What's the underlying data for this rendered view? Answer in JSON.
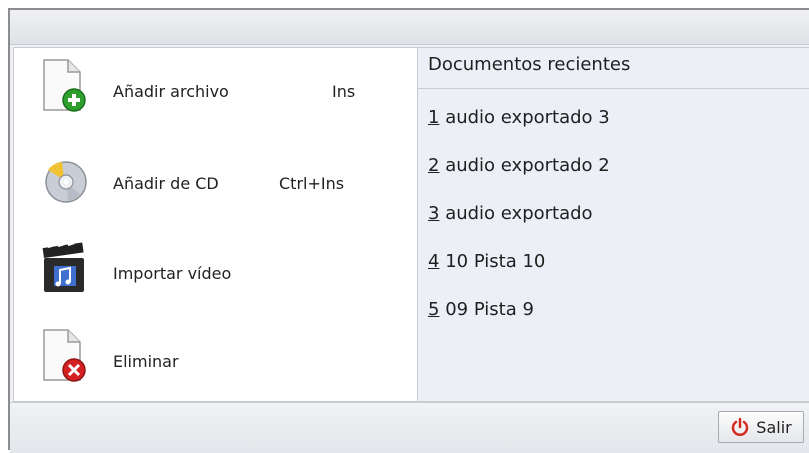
{
  "menu": {
    "commands": [
      {
        "label": "Añadir archivo",
        "shortcut": "Ins",
        "icon": "add-file-icon"
      },
      {
        "label": "Añadir de CD",
        "shortcut": "Ctrl+Ins",
        "icon": "cd-icon"
      },
      {
        "label": "Importar vídeo",
        "shortcut": "",
        "icon": "video-clapper-icon"
      },
      {
        "label": "Eliminar",
        "shortcut": "",
        "icon": "remove-file-icon"
      }
    ]
  },
  "recent": {
    "title": "Documentos recientes",
    "items": [
      {
        "num": "1",
        "name": "audio exportado 3"
      },
      {
        "num": "2",
        "name": "audio exportado 2"
      },
      {
        "num": "3",
        "name": "audio exportado"
      },
      {
        "num": "4",
        "name": "10 Pista 10"
      },
      {
        "num": "5",
        "name": "09 Pista 9"
      }
    ]
  },
  "footer": {
    "exit_label": "Salir",
    "exit_icon": "power-icon"
  },
  "colors": {
    "add": "#2e9e2e",
    "remove": "#d32020",
    "power": "#d42a1f"
  }
}
